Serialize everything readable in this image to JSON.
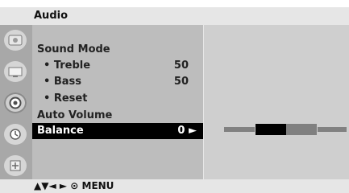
{
  "header": {
    "title": "Audio"
  },
  "sidebar": {
    "items": [
      {
        "icon": "picture-icon"
      },
      {
        "icon": "screen-icon"
      },
      {
        "icon": "audio-icon",
        "active": true
      },
      {
        "icon": "time-icon"
      },
      {
        "icon": "option-icon"
      }
    ]
  },
  "menu": {
    "items": [
      {
        "label": "Sound Mode",
        "type": "main"
      },
      {
        "label": "• Treble",
        "value": "50",
        "type": "sub"
      },
      {
        "label": "• Bass",
        "value": "50",
        "type": "sub"
      },
      {
        "label": "• Reset",
        "type": "sub"
      },
      {
        "label": "Auto Volume",
        "type": "main"
      },
      {
        "label": "Balance",
        "value": "0 ►",
        "type": "main",
        "selected": true
      }
    ]
  },
  "balance_bar": {
    "value": 0,
    "left_fill_color": "#000000",
    "right_fill_color": "#808080"
  },
  "footer": {
    "nav_hint": "▲▼◄ ► ⊙ MENU"
  }
}
